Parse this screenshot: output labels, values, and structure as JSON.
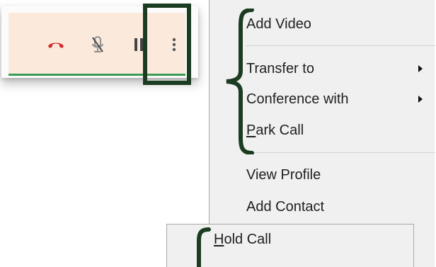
{
  "menu": {
    "items": [
      {
        "label": "Add Video"
      },
      {
        "label": "Transfer to",
        "submenu": true
      },
      {
        "label": "Conference with",
        "submenu": true
      },
      {
        "label_first": "P",
        "label_rest": "ark Call"
      },
      {
        "label": "View Profile"
      },
      {
        "label": "Add Contact"
      }
    ]
  },
  "submenu": {
    "hold_first": "H",
    "hold_rest": "old Call"
  },
  "icons": {
    "hangup": "hangup-icon",
    "mute": "mute-icon",
    "hold": "pause-icon",
    "more": "more-vertical-icon"
  },
  "colors": {
    "accent_green": "#3a9c54",
    "toolbar_bg": "#fbe9dc",
    "hangup_red": "#d32a2a",
    "highlight": "#1c3c22"
  }
}
